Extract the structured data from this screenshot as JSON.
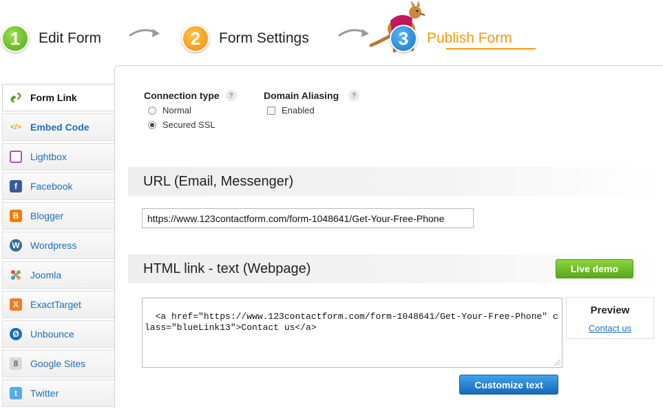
{
  "steps": [
    {
      "number": "1",
      "label": "Edit Form"
    },
    {
      "number": "2",
      "label": "Form Settings"
    },
    {
      "number": "3",
      "label": "Publish Form"
    }
  ],
  "sidebar": {
    "items": [
      {
        "label": "Form Link",
        "icon": "link-icon"
      },
      {
        "label": "Embed Code",
        "icon": "code-icon"
      },
      {
        "label": "Lightbox",
        "icon": "lightbox-icon"
      },
      {
        "label": "Facebook",
        "icon": "facebook-icon"
      },
      {
        "label": "Blogger",
        "icon": "blogger-icon"
      },
      {
        "label": "Wordpress",
        "icon": "wordpress-icon"
      },
      {
        "label": "Joomla",
        "icon": "joomla-icon"
      },
      {
        "label": "ExactTarget",
        "icon": "exacttarget-icon"
      },
      {
        "label": "Unbounce",
        "icon": "unbounce-icon"
      },
      {
        "label": "Google Sites",
        "icon": "google-sites-icon"
      },
      {
        "label": "Twitter",
        "icon": "twitter-icon"
      }
    ]
  },
  "connection": {
    "title": "Connection type",
    "help": "?",
    "options": [
      "Normal",
      "Secured SSL"
    ],
    "selected": "Secured SSL"
  },
  "aliasing": {
    "title": "Domain Aliasing",
    "help": "?",
    "checkbox_label": "Enabled"
  },
  "url_section": {
    "title": "URL (Email, Messenger)",
    "url": "https://www.123contactform.com/form-1048641/Get-Your-Free-Phone"
  },
  "html_section": {
    "title": "HTML link - text (Webpage)",
    "live_demo": "Live demo",
    "code": "<a href=\"https://www.123contactform.com/form-1048641/Get-Your-Free-Phone\" class=\"blueLink13\">Contact us</a>",
    "preview_title": "Preview",
    "preview_link": "Contact us",
    "customize": "Customize text"
  },
  "colors": {
    "accent_orange": "#f29a0c",
    "link_blue": "#1d6fb8",
    "live_demo_green": "#57a81b",
    "customize_blue": "#1568b8"
  }
}
